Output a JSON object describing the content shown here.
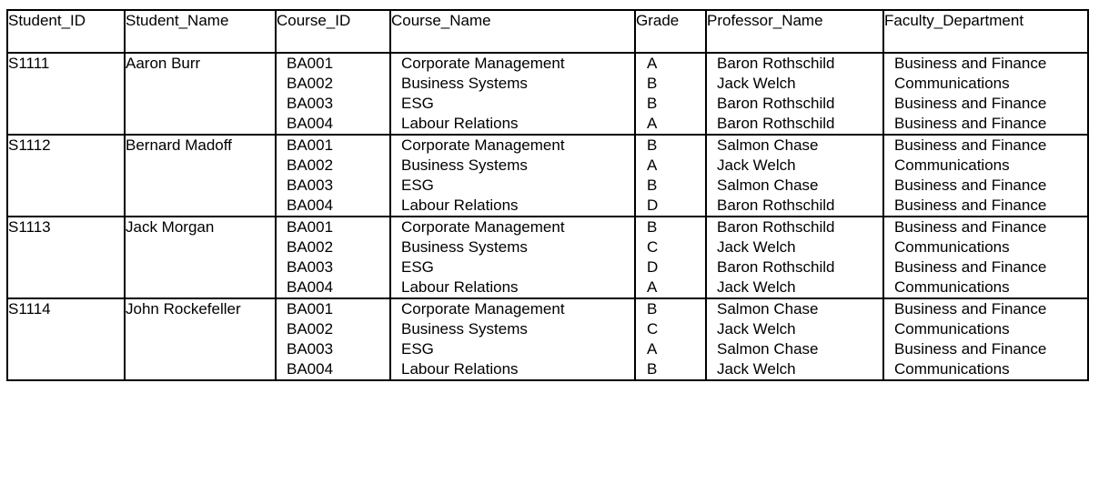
{
  "table": {
    "columns": [
      {
        "key": "student_id",
        "label": "Student_ID"
      },
      {
        "key": "student_name",
        "label": "Student_Name"
      },
      {
        "key": "course_id",
        "label": "Course_ID"
      },
      {
        "key": "course_name",
        "label": "Course_Name"
      },
      {
        "key": "grade",
        "label": "Grade"
      },
      {
        "key": "professor_name",
        "label": "Professor_Name"
      },
      {
        "key": "faculty_department",
        "label": "Faculty_Department"
      }
    ],
    "rows": [
      {
        "student_id": "S1111",
        "student_name": "Aaron Burr",
        "course_id": [
          "BA001",
          "BA002",
          "BA003",
          "BA004"
        ],
        "course_name": [
          "Corporate Management",
          "Business Systems",
          "ESG",
          "Labour Relations"
        ],
        "grade": [
          "A",
          "B",
          "B",
          "A"
        ],
        "professor_name": [
          "Baron Rothschild",
          "Jack Welch",
          "Baron Rothschild",
          "Baron Rothschild"
        ],
        "faculty_department": [
          "Business and Finance",
          "Communications",
          "Business and Finance",
          "Business and Finance"
        ]
      },
      {
        "student_id": "S1112",
        "student_name": "Bernard Madoff",
        "course_id": [
          "BA001",
          "BA002",
          "BA003",
          "BA004"
        ],
        "course_name": [
          "Corporate Management",
          "Business Systems",
          "ESG",
          "Labour Relations"
        ],
        "grade": [
          "B",
          "A",
          "B",
          "D"
        ],
        "professor_name": [
          "Salmon Chase",
          "Jack Welch",
          "Salmon Chase",
          "Baron Rothschild"
        ],
        "faculty_department": [
          "Business and Finance",
          "Communications",
          "Business and Finance",
          "Business and Finance"
        ]
      },
      {
        "student_id": "S1113",
        "student_name": "Jack Morgan",
        "course_id": [
          "BA001",
          "BA002",
          "BA003",
          "BA004"
        ],
        "course_name": [
          "Corporate Management",
          "Business Systems",
          "ESG",
          "Labour Relations"
        ],
        "grade": [
          "B",
          "C",
          "D",
          "A"
        ],
        "professor_name": [
          "Baron Rothschild",
          "Jack Welch",
          "Baron Rothschild",
          "Jack Welch"
        ],
        "faculty_department": [
          "Business and Finance",
          "Communications",
          "Business and Finance",
          "Communications"
        ]
      },
      {
        "student_id": "S1114",
        "student_name": "John Rockefeller",
        "course_id": [
          "BA001",
          "BA002",
          "BA003",
          "BA004"
        ],
        "course_name": [
          "Corporate Management",
          "Business Systems",
          "ESG",
          "Labour Relations"
        ],
        "grade": [
          "B",
          "C",
          "A",
          "B"
        ],
        "professor_name": [
          "Salmon Chase",
          "Jack Welch",
          "Salmon Chase",
          "Jack Welch"
        ],
        "faculty_department": [
          "Business and Finance",
          "Communications",
          "Business and Finance",
          "Communications"
        ]
      }
    ]
  },
  "style": {
    "border_color": "#000000",
    "text_color": "#000000",
    "background": "#ffffff"
  }
}
